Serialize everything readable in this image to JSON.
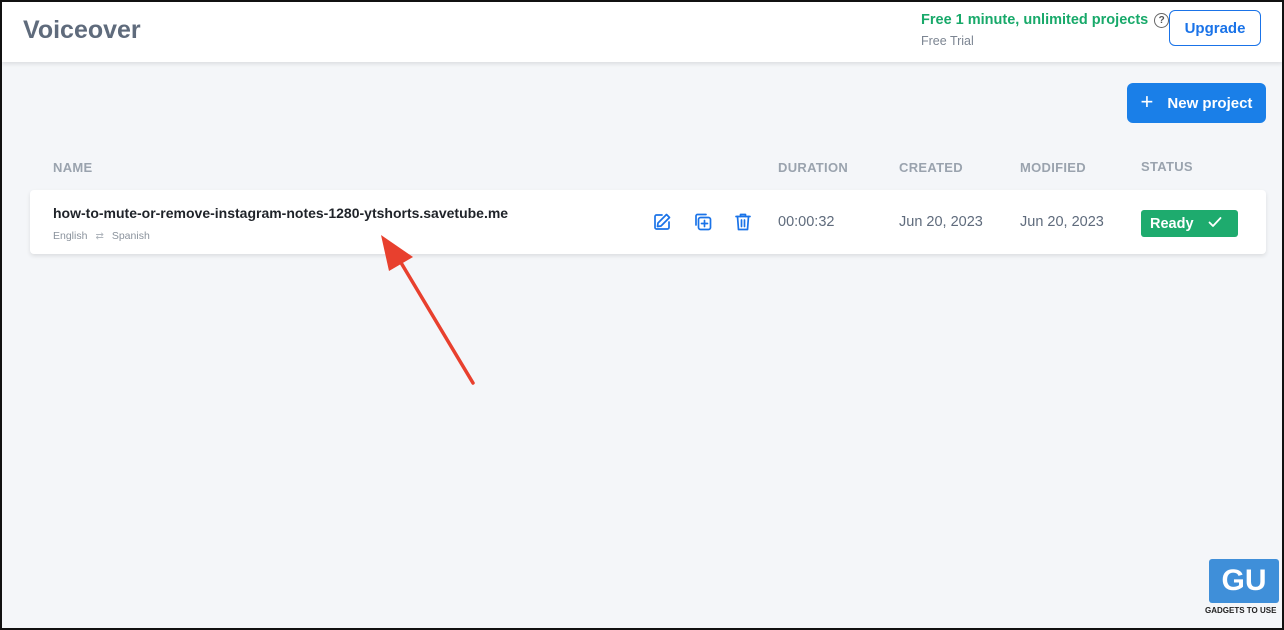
{
  "header": {
    "title": "Voiceover",
    "trial_main": "Free 1 minute, unlimited projects",
    "trial_sub": "Free Trial",
    "upgrade_label": "Upgrade"
  },
  "toolbar": {
    "new_project_label": "New project"
  },
  "table": {
    "columns": [
      "NAME",
      "DURATION",
      "CREATED",
      "MODIFIED",
      "STATUS"
    ],
    "rows": [
      {
        "name": "how-to-mute-or-remove-instagram-notes-1280-ytshorts.savetube.me",
        "source_lang": "English",
        "target_lang": "Spanish",
        "duration": "00:00:32",
        "created": "Jun 20, 2023",
        "modified": "Jun 20, 2023",
        "status": "Ready"
      }
    ]
  },
  "watermark": {
    "logo": "GU",
    "text": "GADGETS TO USE"
  },
  "icons": {
    "edit": "edit-icon",
    "duplicate": "duplicate-icon",
    "delete": "trash-icon",
    "check": "check-icon",
    "help": "help-icon",
    "plus": "plus-icon",
    "swap": "swap-icon"
  },
  "colors": {
    "accent": "#1a7fe8",
    "success": "#1eab6e",
    "trial_text": "#18a96a",
    "annotation_arrow": "#e8402e"
  }
}
